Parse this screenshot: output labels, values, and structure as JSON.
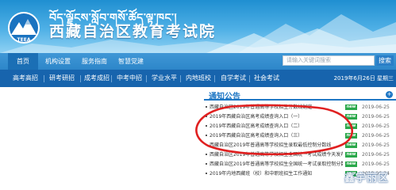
{
  "header": {
    "tibetan_title": "བོད་ལྗོངས་སློབ་གསོ་ཚོད་ལྟ་ཁང་།",
    "site_title": "西藏自治区教育考试院",
    "logo_icon": "mountain-logo-icon",
    "logo_text": "TEEA"
  },
  "search": {
    "placeholder": "请输入关键词搜索",
    "button_label": "搜索"
  },
  "nav_primary": [
    {
      "label": "首页",
      "active": true
    },
    {
      "label": "机构设置",
      "active": false
    },
    {
      "label": "服务指南",
      "active": false
    },
    {
      "label": "智慧党建",
      "active": false
    }
  ],
  "nav_secondary": {
    "items": [
      "高考高招",
      "研考研招",
      "成考成招",
      "中考中招",
      "学业水平",
      "内地班校",
      "自学考试",
      "社会考试"
    ],
    "date": "2019年6月26日 星期三"
  },
  "notice": {
    "title": "通知公告",
    "more_icon": "more-icon",
    "items": [
      {
        "text": "西藏自治区2019年普通高等学校招生分数线划定",
        "new": true,
        "date": "2019-06-25"
      },
      {
        "text": "2019年西藏自治区高考成绩查询入口（一）",
        "new": true,
        "date": "2019-06-25"
      },
      {
        "text": "2019年西藏自治区高考成绩查询入口（二）",
        "new": true,
        "date": "2019-06-25"
      },
      {
        "text": "2019年西藏自治区高考成绩查询入口（三）",
        "new": true,
        "date": "2019-06-25"
      },
      {
        "text": "西藏自治区2019年普通高等学校招生录取最低控制分数线",
        "new": true,
        "date": "2019-06-25"
      },
      {
        "text": "西藏自治区2019年普通高等学校招生全国统一考试成绩今天发布",
        "new": true,
        "date": "2019-06-25"
      },
      {
        "text": "西藏自治区2019年普通高等学校招生全国统一考试录取控制分数线",
        "new": true,
        "date": "2019-06-25"
      },
      {
        "text": "2019年内地西藏班（校）和中职班招生工作通知",
        "new": true,
        "date": "2019-06-24"
      }
    ],
    "new_badge": "new"
  },
  "annotation": {
    "color": "#e02020"
  },
  "watermark": {
    "text": "鑫宇丽区"
  }
}
